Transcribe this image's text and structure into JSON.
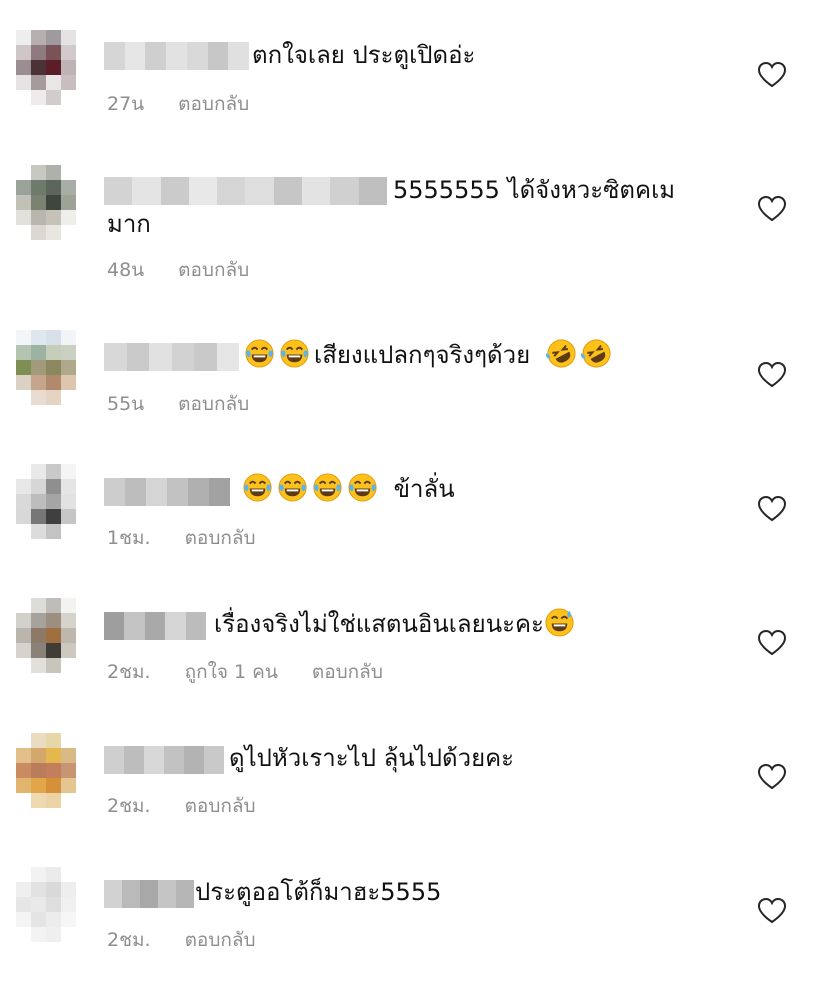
{
  "comments": [
    {
      "text": "ตกใจเลย ประตูเปิดอ่ะ",
      "time": "27น",
      "reply": "ตอบกลับ"
    },
    {
      "text": "5555555 ได้จังหวะซิตคเม",
      "text2": "มาก",
      "time": "48น",
      "reply": "ตอบกลับ"
    },
    {
      "text": "เสียงแปลกๆจริงๆด้วย",
      "time": "55น",
      "reply": "ตอบกลับ"
    },
    {
      "text": "ข้าลั่น",
      "time": "1ชม.",
      "reply": "ตอบกลับ"
    },
    {
      "text": "เรื่องจริงไม่ใช่แสตนอินเลยนะคะ",
      "time": "2ชม.",
      "likes": "ถูกใจ 1 คน",
      "reply": "ตอบกลับ"
    },
    {
      "text": "ดูไปหัวเราะไป ลุ้นไปด้วยคะ",
      "time": "2ชม.",
      "reply": "ตอบกลับ"
    },
    {
      "text": "ประตูออโต้ก็มาฮะ5555",
      "time": "2ชม.",
      "reply": "ตอบกลับ"
    }
  ],
  "icons": {
    "heart": "heart-outline-icon",
    "laugh": "face-with-tears-of-joy-emoji",
    "rofl": "rolling-on-floor-laughing-emoji",
    "sweat": "grinning-face-with-sweat-emoji"
  },
  "colors": {
    "meta": "#8e8e8e",
    "text": "#111111"
  }
}
